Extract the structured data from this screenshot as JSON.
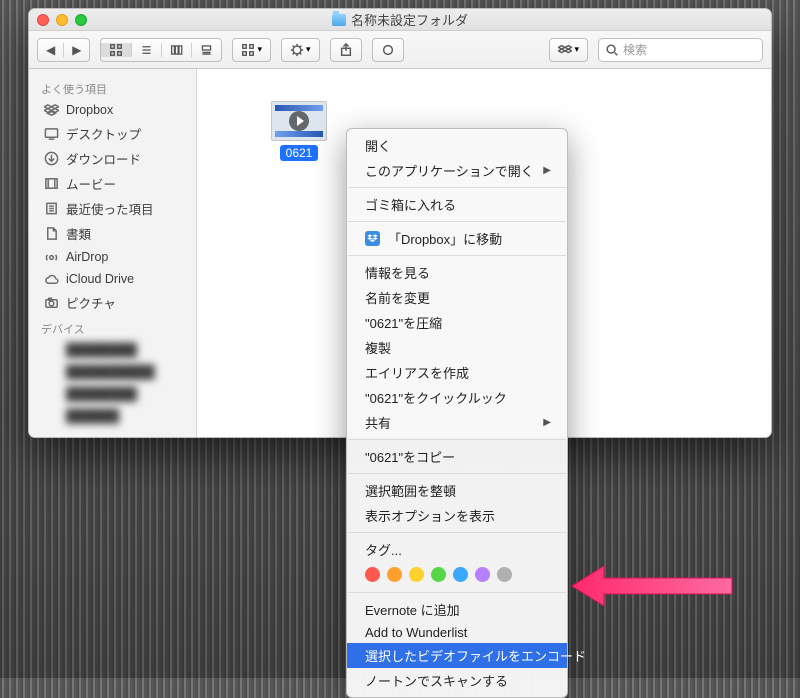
{
  "window": {
    "title": "名称未設定フォルダ"
  },
  "search": {
    "placeholder": "検索"
  },
  "sidebar": {
    "section_favorites": "よく使う項目",
    "section_devices": "デバイス",
    "items": [
      {
        "label": "Dropbox"
      },
      {
        "label": "デスクトップ"
      },
      {
        "label": "ダウンロード"
      },
      {
        "label": "ムービー"
      },
      {
        "label": "最近使った項目"
      },
      {
        "label": "書類"
      },
      {
        "label": "AirDrop"
      },
      {
        "label": "iCloud Drive"
      },
      {
        "label": "ピクチャ"
      }
    ]
  },
  "file": {
    "name": "0621"
  },
  "menu": {
    "open": "開く",
    "open_with": "このアプリケーションで開く",
    "trash": "ゴミ箱に入れる",
    "move_dropbox": "「Dropbox」に移動",
    "get_info": "情報を見る",
    "rename": "名前を変更",
    "compress": "\"0621\"を圧縮",
    "duplicate": "複製",
    "alias": "エイリアスを作成",
    "quicklook": "\"0621\"をクイックルック",
    "share": "共有",
    "copy": "\"0621\"をコピー",
    "clean_selection": "選択範囲を整頓",
    "view_options": "表示オプションを表示",
    "tags": "タグ...",
    "evernote": "Evernote に追加",
    "wunderlist": "Add to Wunderlist",
    "encode": "選択したビデオファイルをエンコード",
    "norton": "ノートンでスキャンする"
  },
  "tag_colors": [
    "#ff5a4d",
    "#ff9f2e",
    "#ffd02e",
    "#58d64a",
    "#3aa7ff",
    "#b780ff",
    "#b0b0b0"
  ]
}
